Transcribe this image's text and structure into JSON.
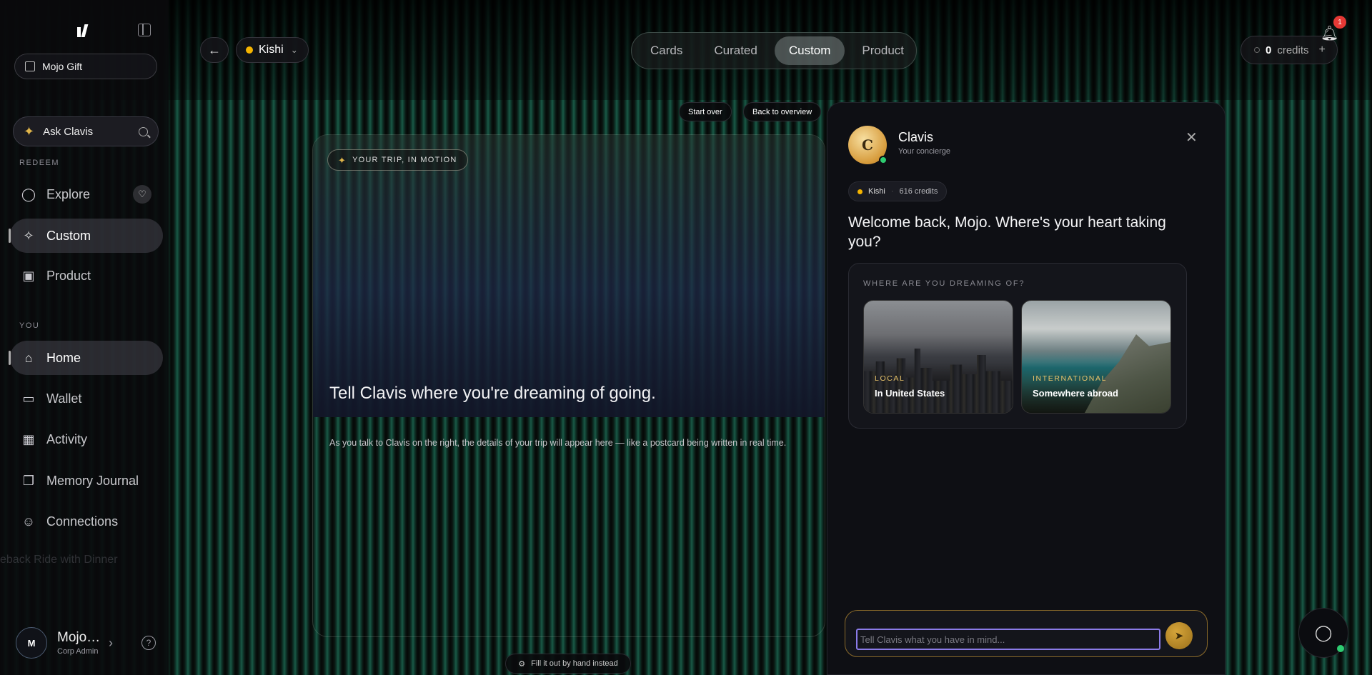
{
  "sidebar": {
    "org_name": "Mojo Gift",
    "ask_label": "Ask Clavis",
    "section_redeem": "REDEEM",
    "section_you": "YOU",
    "redeem_items": [
      {
        "label": "Explore",
        "icon": "globe-icon"
      },
      {
        "label": "Custom",
        "icon": "sparkle-icon"
      },
      {
        "label": "Product",
        "icon": "gift-icon"
      }
    ],
    "you_items": [
      {
        "label": "Home",
        "icon": "home-icon"
      },
      {
        "label": "Wallet",
        "icon": "wallet-icon"
      },
      {
        "label": "Activity",
        "icon": "calendar-check-icon"
      },
      {
        "label": "Memory Journal",
        "icon": "book-icon"
      },
      {
        "label": "Connections",
        "icon": "users-icon"
      }
    ],
    "background_text": "eback Ride with Dinner",
    "user": {
      "initial": "M",
      "name": "Mojo…",
      "role": "Corp Admin"
    }
  },
  "topbar": {
    "account": "Kishi",
    "tabs": [
      "Cards",
      "Curated",
      "Custom",
      "Product"
    ],
    "active_tab": "Custom",
    "credits_value": "0",
    "credits_label": "credits",
    "notification_count": "1"
  },
  "actions": {
    "start_over": "Start over",
    "back_overview": "Back to overview",
    "fill_hand": "Fill it out by hand instead"
  },
  "trip_card": {
    "badge": "YOUR TRIP, IN MOTION",
    "title": "Tell Clavis where you're dreaming of going.",
    "body": "As you talk to Clavis on the right, the details of your trip will appear here — like a postcard being written in real time."
  },
  "chat": {
    "avatar_letter": "C",
    "name": "Clavis",
    "subtitle": "Your concierge",
    "account": "Kishi",
    "credits": "616 credits",
    "welcome": "Welcome back, Mojo. Where's your heart taking you?",
    "question": "WHERE ARE YOU DREAMING OF?",
    "options": [
      {
        "tag": "LOCAL",
        "label": "In United States"
      },
      {
        "tag": "INTERNATIONAL",
        "label": "Somewhere abroad"
      }
    ],
    "input_placeholder": "Tell Clavis what you have in mind..."
  },
  "colors": {
    "accent_gold": "#e0b54a",
    "online_green": "#2ecc71",
    "badge_red": "#e53935"
  }
}
